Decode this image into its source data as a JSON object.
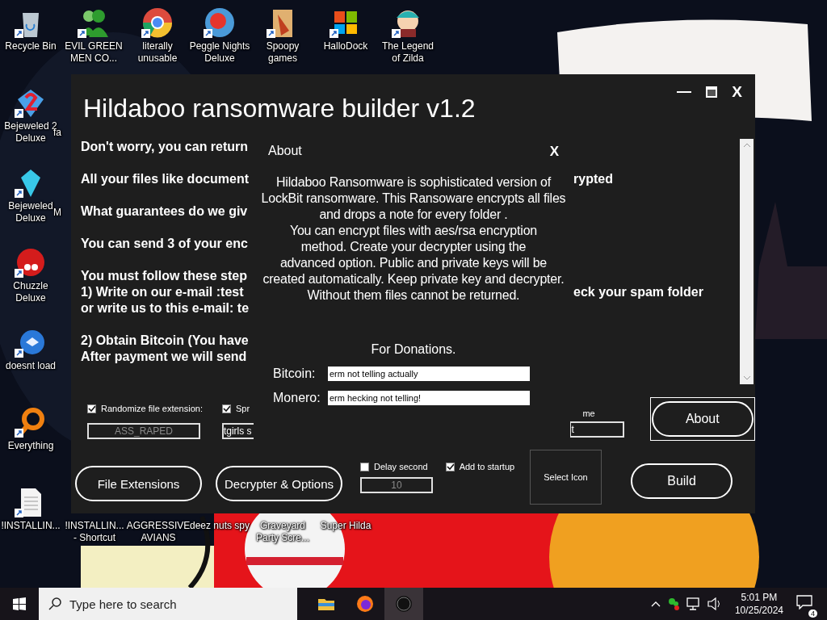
{
  "desktop": {
    "icons": [
      {
        "label_lines": [
          "Recycle Bin"
        ]
      },
      {
        "label_lines": [
          "EVIL GREEN",
          "MEN CO..."
        ]
      },
      {
        "label_lines": [
          "literally",
          "unusable"
        ]
      },
      {
        "label_lines": [
          "Peggle Nights",
          "Deluxe"
        ]
      },
      {
        "label_lines": [
          "Spoopy",
          "games"
        ]
      },
      {
        "label_lines": [
          "HalloDock"
        ]
      },
      {
        "label_lines": [
          "The Legend",
          "of Zilda"
        ]
      },
      {
        "label_lines": [
          "Bejeweled 2",
          "Deluxe"
        ]
      },
      {
        "label_lines": [
          "Bejeweled",
          "Deluxe"
        ]
      },
      {
        "label_lines": [
          "Chuzzle",
          "Deluxe"
        ]
      },
      {
        "label_lines": [
          "doesnt load"
        ]
      },
      {
        "label_lines": [
          "Everything"
        ]
      },
      {
        "label_lines": [
          "!INSTALLIN..."
        ]
      },
      {
        "label_lines": [
          "!INSTALLIN...",
          "- Shortcut"
        ]
      },
      {
        "label_lines": [
          "AGGRESSIVE",
          "AVIANS"
        ]
      },
      {
        "label_lines": [
          "deez nuts spy"
        ]
      },
      {
        "label_lines": [
          "Graveyard",
          "Party Scre..."
        ]
      },
      {
        "label_lines": [
          "Super Hilda"
        ]
      },
      {
        "label_lines": [
          "fa"
        ]
      },
      {
        "label_lines": [
          "M"
        ]
      }
    ]
  },
  "builder": {
    "title": "Hildaboo ransomware builder v1.2",
    "close": "X",
    "note_paragraphs": [
      [
        {
          "left": "Don't worry, you can return"
        }
      ],
      [
        {
          "left": "All your files like document",
          "right": "rypted"
        }
      ],
      [
        {
          "left": "What guarantees do we giv"
        }
      ],
      [
        {
          "left": "You can send 3 of your enc"
        }
      ],
      [
        {
          "left": "You must follow these step"
        },
        {
          "left": "1) Write on our e-mail :test",
          "right": "eck your spam folder"
        },
        {
          "left": "or write us to this e-mail: te"
        }
      ],
      [
        {
          "left": "2) Obtain Bitcoin (You have"
        },
        {
          "left": "After payment we will send"
        }
      ]
    ],
    "randomize": {
      "label": "Randomize file extension:",
      "checked": true,
      "value": "ASS_RAPED",
      "disabled": true
    },
    "spread": {
      "label": "Spr",
      "checked": true,
      "value": "tgirls s"
    },
    "name_field": {
      "label": "me",
      "value": "t"
    },
    "delay": {
      "label": "Delay second",
      "checked": false,
      "value": "10",
      "disabled": true
    },
    "startup": {
      "label": "Add to startup",
      "checked": true
    },
    "select_icon": "Select Icon",
    "buttons": {
      "file_extensions": "File Extensions",
      "decrypter": "Decrypter & Options",
      "about": "About",
      "build": "Build"
    },
    "about_dialog": {
      "title": "About",
      "close": "X",
      "body_lines": [
        "Hildaboo Ransomware is sophisticated version of",
        "LockBit ransomware. This Ransoware encrypts all files",
        "and drops a note for every folder .",
        "You can  encrypt  files with aes/rsa encryption",
        "method. Create your decrypter using the",
        "advanced option. Public and private keys will be",
        "created automatically. Keep private key and decrypter.",
        "Without them files cannot be returned."
      ],
      "donations": "For Donations.",
      "fields": [
        {
          "label": "Bitcoin:",
          "value": "erm not telling actually"
        },
        {
          "label": "Monero:",
          "value": "erm hecking not telling!"
        }
      ]
    }
  },
  "taskbar": {
    "search": {
      "placeholder": "Type here to search"
    },
    "time": "5:01 PM",
    "date": "10/25/2024",
    "notifications": "4"
  }
}
